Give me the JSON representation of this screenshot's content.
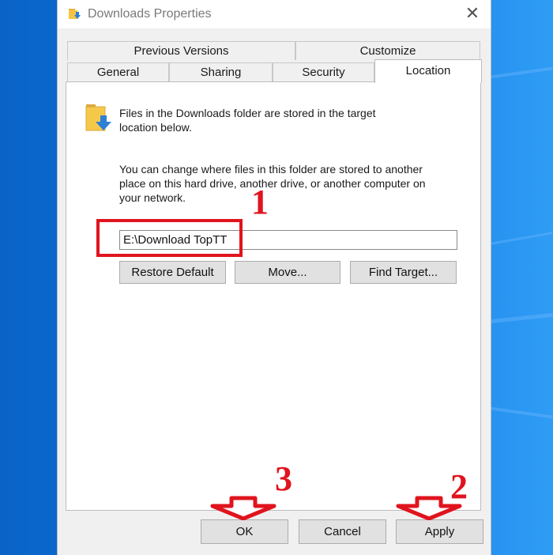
{
  "window": {
    "title": "Downloads Properties",
    "close_glyph": "✕"
  },
  "tabs": {
    "row1": [
      "Previous Versions",
      "Customize"
    ],
    "row2": [
      "General",
      "Sharing",
      "Security",
      "Location"
    ],
    "active": "Location"
  },
  "location": {
    "intro_line1": "Files in the Downloads folder are stored in the target",
    "intro_line2": "location below.",
    "desc_line1": "You can change where files in this folder are stored to another",
    "desc_line2": "place on this hard drive, another drive, or another computer on",
    "desc_line3": "your network.",
    "path_value": "E:\\Download TopTT",
    "restore_label": "Restore Default",
    "move_label": "Move...",
    "find_target_label": "Find Target..."
  },
  "footer": {
    "ok_label": "OK",
    "cancel_label": "Cancel",
    "apply_label": "Apply"
  },
  "annotations": {
    "step1": "1",
    "step2": "2",
    "step3": "3",
    "color": "#e0141e"
  },
  "icons": [
    "downloads-folder-icon",
    "close-icon",
    "arrow-down-icon"
  ]
}
